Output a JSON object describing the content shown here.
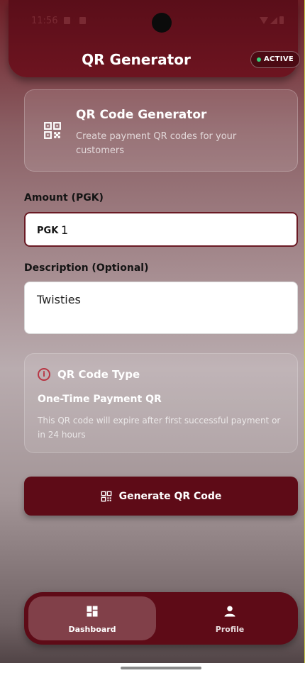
{
  "status": {
    "time": "11:56"
  },
  "header": {
    "title": "QR Generator",
    "badge": "ACTIVE"
  },
  "info_card": {
    "title": "QR Code Generator",
    "subtitle": "Create payment QR codes for your customers",
    "icon": "qr-code-icon"
  },
  "amount": {
    "label": "Amount (PGK)",
    "prefix": "PGK",
    "value": "1"
  },
  "description": {
    "label": "Description (Optional)",
    "value": "Twisties"
  },
  "qr_type": {
    "title": "QR Code Type",
    "type_name": "One-Time Payment QR",
    "detail": "This QR code will expire after first successful payment or in 24 hours",
    "icon": "info-icon"
  },
  "generate_button": {
    "label": "Generate QR Code",
    "icon": "qr-code-icon"
  },
  "bottom_nav": {
    "items": [
      {
        "label": "Dashboard",
        "icon": "dashboard-icon",
        "active": true
      },
      {
        "label": "Profile",
        "icon": "person-icon",
        "active": false
      }
    ]
  },
  "colors": {
    "primary": "#5e0b17",
    "active_dot": "#36d17a",
    "info": "#b83745"
  }
}
